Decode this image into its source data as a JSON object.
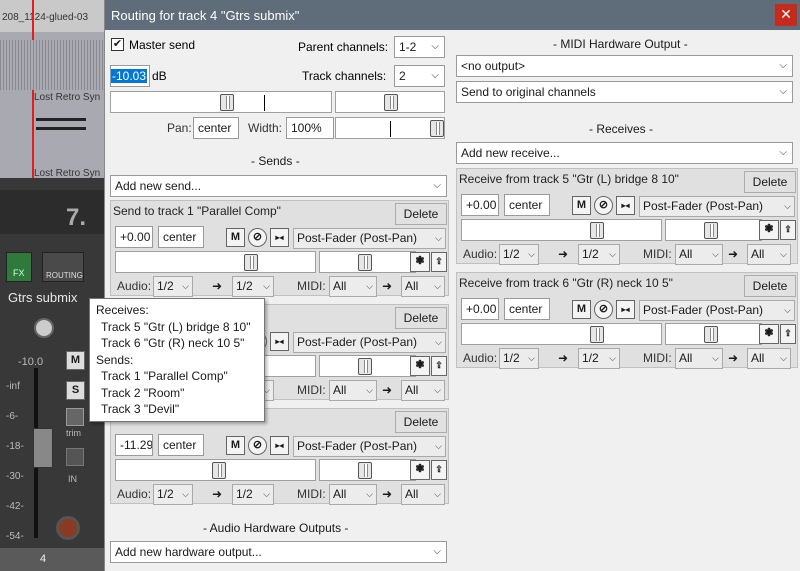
{
  "background": {
    "clip_name_top": "208_1124-glued-03",
    "clip_name_1": "Lost Retro Syn",
    "clip_name_2": "Lost Retro Syn",
    "track_number_big": "7.",
    "fx_label": "FX",
    "routing_label": "ROUTING",
    "track_name": "Gtrs submix",
    "volume_readout": "-10.0",
    "meter_scale": [
      "-inf",
      "-6-",
      "-18-",
      "-30-",
      "-42-",
      "-54-"
    ],
    "trim_label": "trim",
    "track_index": "4",
    "mute_label": "M",
    "solo_label": "S",
    "in_label": "IN"
  },
  "dialog": {
    "title": "Routing for track 4 \"Gtrs submix\"",
    "close": "✕",
    "master_send_label": "Master send",
    "master_send_checked": true,
    "parent_channels_label": "Parent channels:",
    "parent_channels_value": "1-2",
    "volume_value": "-10.03",
    "volume_unit": "dB",
    "track_channels_label": "Track channels:",
    "track_channels_value": "2",
    "pan_label": "Pan:",
    "pan_value": "center",
    "width_label": "Width:",
    "width_value": "100%",
    "sends_header": "- Sends -",
    "add_new_send": "Add new send...",
    "audio_hw_header": "- Audio Hardware Outputs -",
    "add_new_hw_output": "Add new hardware output...",
    "midi_hw_header": "- MIDI Hardware Output -",
    "midi_output": "<no output>",
    "midi_channels": "Send to original channels",
    "receives_header": "- Receives -",
    "add_new_receive": "Add new receive..."
  },
  "sends": [
    {
      "title": "Send to track 1 \"Parallel Comp\"",
      "delete": "Delete",
      "volume": "+0.00",
      "pan": "center",
      "mode": "Post-Fader (Post-Pan)",
      "audio_label": "Audio:",
      "audio_src": "1/2",
      "audio_dst": "1/2",
      "midi_label": "MIDI:",
      "midi_src": "All",
      "midi_dst": "All"
    },
    {
      "title": "",
      "delete": "Delete",
      "volume": "",
      "pan": "",
      "mode": "Post-Fader (Post-Pan)",
      "audio_label": "",
      "audio_src": "",
      "audio_dst": "",
      "midi_label": "MIDI:",
      "midi_src": "All",
      "midi_dst": "All"
    },
    {
      "title": "",
      "delete": "Delete",
      "volume": "-11.29",
      "pan": "center",
      "mode": "Post-Fader (Post-Pan)",
      "audio_label": "Audio:",
      "audio_src": "1/2",
      "audio_dst": "1/2",
      "midi_label": "MIDI:",
      "midi_src": "All",
      "midi_dst": "All"
    }
  ],
  "receives": [
    {
      "title": "Receive from track 5 \"Gtr (L) bridge 8 10\"",
      "delete": "Delete",
      "volume": "+0.00",
      "pan": "center",
      "mode": "Post-Fader (Post-Pan)",
      "audio_label": "Audio:",
      "audio_src": "1/2",
      "audio_dst": "1/2",
      "midi_label": "MIDI:",
      "midi_src": "All",
      "midi_dst": "All"
    },
    {
      "title": "Receive from track 6 \"Gtr (R) neck 10 5\"",
      "delete": "Delete",
      "volume": "+0.00",
      "pan": "center",
      "mode": "Post-Fader (Post-Pan)",
      "audio_label": "Audio:",
      "audio_src": "1/2",
      "audio_dst": "1/2",
      "midi_label": "MIDI:",
      "midi_src": "All",
      "midi_dst": "All"
    }
  ],
  "buttons": {
    "mute": "M",
    "phase": "⊘",
    "mono": "▸◂",
    "arrow": "➜"
  },
  "tooltip": {
    "receives_label": "Receives:",
    "receives": [
      "Track 5 \"Gtr (L) bridge 8 10\"",
      "Track 6 \"Gtr (R) neck 10 5\""
    ],
    "sends_label": "Sends:",
    "sends": [
      "Track 1 \"Parallel Comp\"",
      "Track 2 \"Room\"",
      "Track 3 \"Devil\""
    ]
  },
  "colors": {
    "titlebar": "#5f6d7b",
    "close": "#c42b1c",
    "selection": "#0078d7"
  }
}
